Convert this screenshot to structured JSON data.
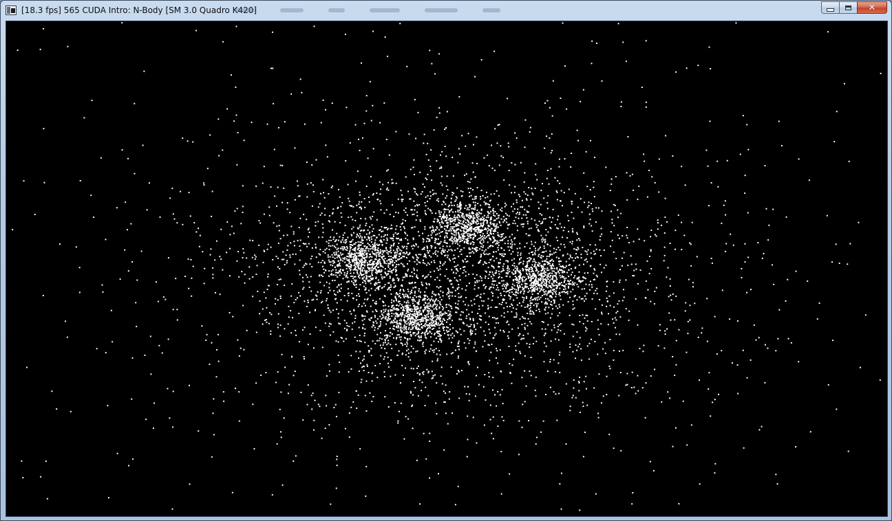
{
  "window": {
    "title": "[18.3 fps] 565 CUDA Intro: N-Body [SM 3.0 Quadro K420]",
    "background_color": "#000000",
    "particle_color": "#ffffff"
  },
  "titlebar": {
    "icon": "app-window-icon",
    "buttons": [
      {
        "name": "minimize-button",
        "icon": "minimize-icon"
      },
      {
        "name": "maximize-button",
        "icon": "maximize-icon"
      },
      {
        "name": "close-button",
        "icon": "close-icon",
        "glyph": "✕"
      }
    ]
  },
  "simulation": {
    "type": "n-body particle render",
    "clusters": 4
  }
}
